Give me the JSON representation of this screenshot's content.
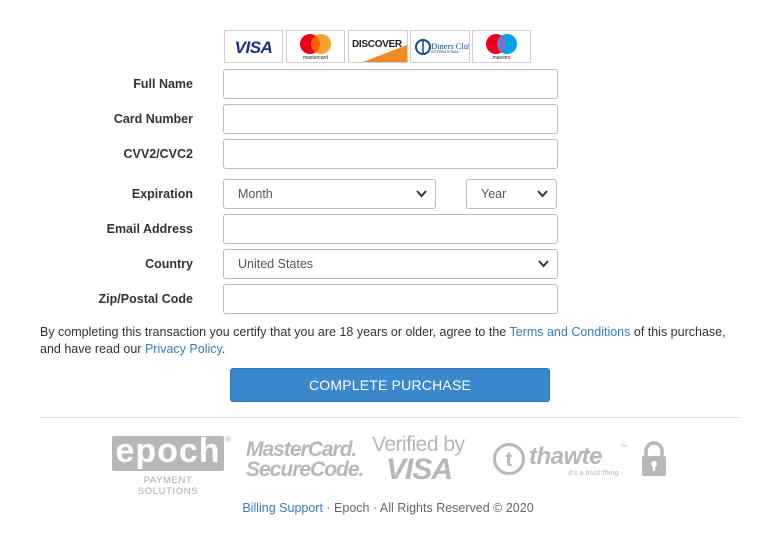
{
  "card_logos": [
    {
      "name": "visa",
      "text": "VISA"
    },
    {
      "name": "mastercard",
      "text": "mastercard"
    },
    {
      "name": "discover",
      "text": "DISCOVER"
    },
    {
      "name": "diners-club",
      "text": "Diners Club",
      "subtext": "INTERNATIONAL"
    },
    {
      "name": "maestro",
      "text": "maestro"
    }
  ],
  "form": {
    "full_name_label": "Full Name",
    "card_number_label": "Card Number",
    "cvv_label": "CVV2/CVC2",
    "expiration_label": "Expiration",
    "month_value": "Month",
    "year_value": "Year",
    "email_label": "Email Address",
    "country_label": "Country",
    "country_value": "United States",
    "zip_label": "Zip/Postal Code"
  },
  "terms": {
    "prefix": "By completing this transaction you certify that you are 18 years or older, agree to the ",
    "terms_link": "Terms and Conditions",
    "middle": " of this purchase, and have read our ",
    "privacy_link": "Privacy Policy",
    "suffix": "."
  },
  "submit_label": "COMPLETE PURCHASE",
  "badges": {
    "epoch_text": "epoch",
    "epoch_sub": "PAYMENT SOLUTIONS",
    "mc_line1": "MasterCard.",
    "mc_line2": "SecureCode.",
    "verified_line1": "Verified by",
    "verified_line2": "VISA",
    "thawte_text": "thawte",
    "thawte_tag": "It's a trust thing"
  },
  "footer": {
    "billing_link": "Billing Support",
    "rest": " · Epoch · All Rights Reserved © 2020"
  },
  "colors": {
    "link": "#3a7bbf",
    "button": "#3b88cc",
    "badge_gray": "#b7b7b7"
  }
}
